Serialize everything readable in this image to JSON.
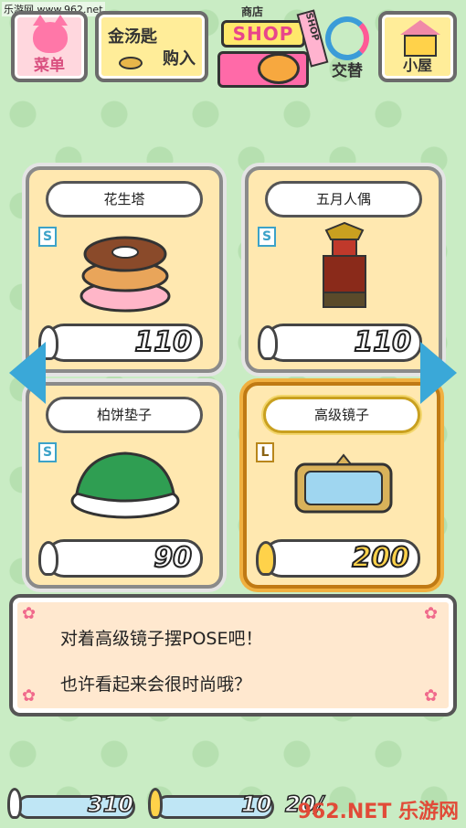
{
  "watermark": {
    "site": "乐游网 www.962.net",
    "bottom": "962.NET 乐游网"
  },
  "top_bar": {
    "menu_label": "菜单",
    "spoon_buy_line1": "金汤匙",
    "spoon_buy_line2": "购入",
    "shop_small": "商店",
    "shop_label": "SHOP",
    "shop_tag": "SHOP",
    "switch_label": "交替",
    "house_label": "小屋"
  },
  "items": [
    {
      "name": "花生塔",
      "size": "S",
      "price": "110",
      "selected": false
    },
    {
      "name": "五月人偶",
      "size": "S",
      "price": "110",
      "selected": false
    },
    {
      "name": "柏饼垫子",
      "size": "S",
      "price": "90",
      "selected": false
    },
    {
      "name": "高级镜子",
      "size": "L",
      "price": "200",
      "selected": true
    }
  ],
  "message": {
    "line1": "对着高级镜子摆POSE吧！",
    "line2": "也许看起来会很时尚哦？"
  },
  "bottom_bar": {
    "silver_spoons": "310",
    "gold_spoons": "10",
    "capacity": "20/"
  },
  "colors": {
    "accent_blue": "#3aa8d8",
    "selected_gold": "#f0b040",
    "card_bg": "#ffe8b0",
    "pink": "#ff77a8"
  }
}
